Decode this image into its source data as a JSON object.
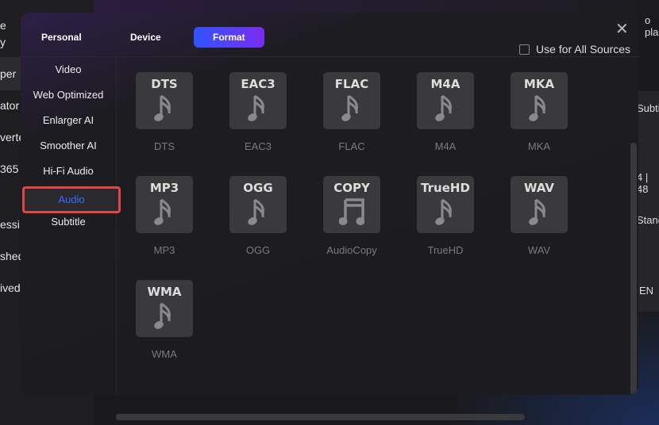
{
  "background": {
    "sidebar_fragments": [
      "e",
      "y",
      "per",
      "ator",
      "verte",
      "365",
      "essi",
      "shed",
      "ived"
    ],
    "right_fragments": [
      "o pla",
      "Subti",
      "4 | 48",
      "Stand",
      "EN"
    ]
  },
  "dialog": {
    "tabs": [
      {
        "label": "Personal"
      },
      {
        "label": "Device"
      },
      {
        "label": "Format",
        "active": true
      }
    ],
    "use_all_label": "Use for All Sources",
    "use_all_checked": false,
    "sidebar": [
      {
        "label": "Video"
      },
      {
        "label": "Web Optimized"
      },
      {
        "label": "Enlarger AI"
      },
      {
        "label": "Smoother AI"
      },
      {
        "label": "Hi-Fi Audio"
      },
      {
        "label": "Audio",
        "selected": true
      },
      {
        "label": "Subtitle"
      }
    ],
    "formats": [
      {
        "badge": "DTS",
        "label": "DTS",
        "icon": "music-note-icon"
      },
      {
        "badge": "EAC3",
        "label": "EAC3",
        "icon": "music-note-icon"
      },
      {
        "badge": "FLAC",
        "label": "FLAC",
        "icon": "music-note-icon"
      },
      {
        "badge": "M4A",
        "label": "M4A",
        "icon": "music-note-icon"
      },
      {
        "badge": "MKA",
        "label": "MKA",
        "icon": "music-note-icon"
      },
      {
        "badge": "MP3",
        "label": "MP3",
        "icon": "music-note-icon"
      },
      {
        "badge": "OGG",
        "label": "OGG",
        "icon": "music-note-icon"
      },
      {
        "badge": "COPY",
        "label": "AudioCopy",
        "icon": "beamed-notes-icon"
      },
      {
        "badge": "TrueHD",
        "label": "TrueHD",
        "icon": "music-note-icon"
      },
      {
        "badge": "WAV",
        "label": "WAV",
        "icon": "music-note-icon"
      },
      {
        "badge": "WMA",
        "label": "WMA",
        "icon": "music-note-icon"
      }
    ]
  },
  "colors": {
    "accent_start": "#2f54ff",
    "accent_end": "#7a2cf2",
    "selection_border": "#e04545",
    "selected_text": "#3a6bff"
  }
}
